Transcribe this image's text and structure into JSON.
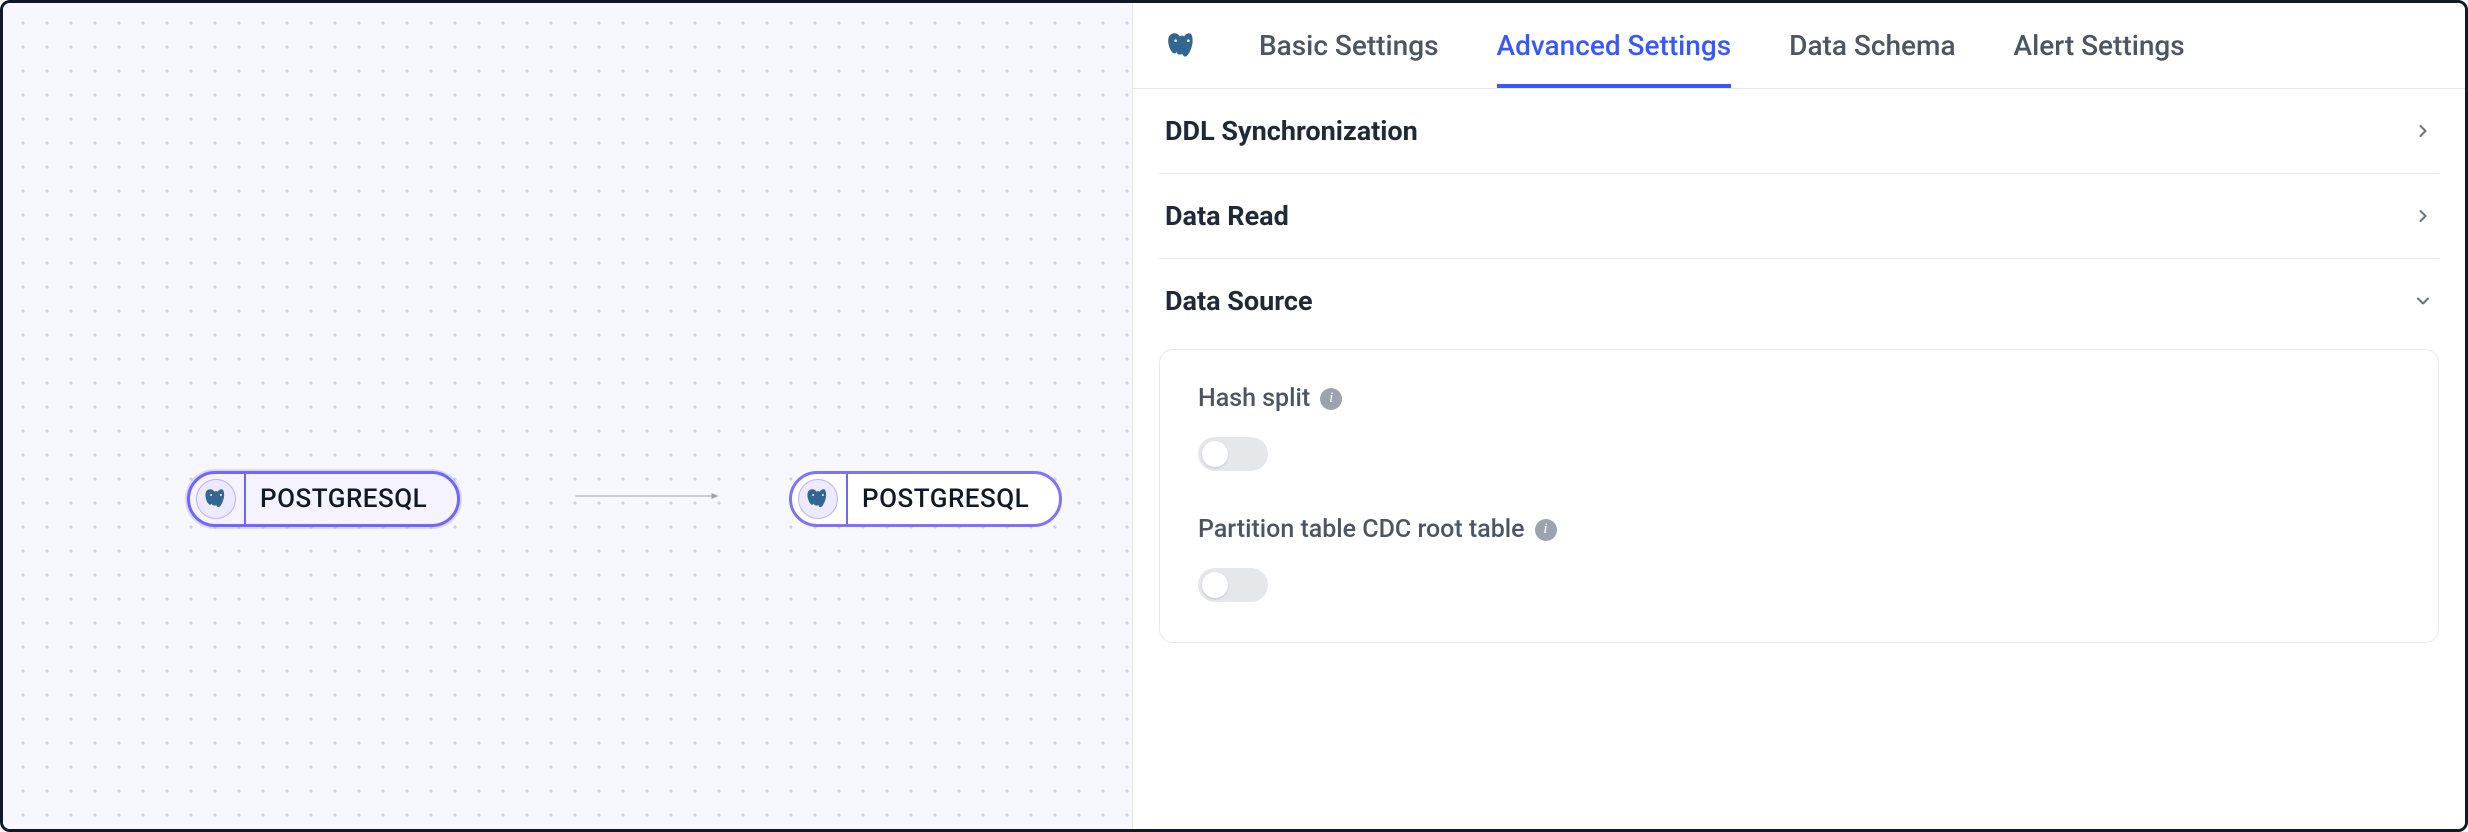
{
  "canvas": {
    "source_node": {
      "label": "POSTGRESQL"
    },
    "target_node": {
      "label": "POSTGRESQL"
    }
  },
  "tabs": {
    "basic": "Basic Settings",
    "advanced": "Advanced Settings",
    "schema": "Data Schema",
    "alert": "Alert Settings",
    "active": "advanced"
  },
  "sections": {
    "ddl": {
      "title": "DDL Synchronization",
      "expanded": false
    },
    "read": {
      "title": "Data Read",
      "expanded": false
    },
    "source": {
      "title": "Data Source",
      "expanded": true,
      "fields": {
        "hash_split": {
          "label": "Hash split",
          "value": false
        },
        "partition_cdc": {
          "label": "Partition table CDC root table",
          "value": false
        }
      }
    }
  }
}
